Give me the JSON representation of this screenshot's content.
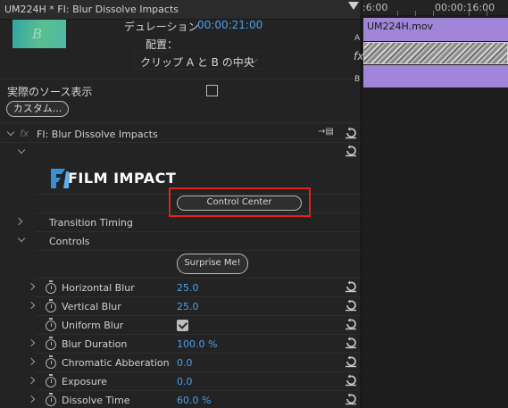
{
  "title": "UM224H * FI: Blur Dissolve Impacts",
  "thumbnail_letter": "B",
  "duration": {
    "label": "デュレーション",
    "value": "00:00:21:00"
  },
  "alignment": {
    "label": "配置：",
    "selected": "クリップ A と B の中央"
  },
  "show_actual_sources": {
    "label": "実際のソース表示",
    "checked": false
  },
  "custom_button": "カスタム...",
  "effect": {
    "name": "FI: Blur Dissolve Impacts",
    "logo_text": "FILM IMPACT",
    "control_center": "Control Center",
    "transition_timing": "Transition Timing",
    "controls": "Controls",
    "surprise": "Surprise Me!"
  },
  "properties": [
    {
      "label": "Horizontal Blur",
      "value": "25.0",
      "type": "value",
      "expandable": true
    },
    {
      "label": "Vertical Blur",
      "value": "25.0",
      "type": "value",
      "expandable": true
    },
    {
      "label": "Uniform Blur",
      "value": "",
      "type": "checkbox",
      "checked": true,
      "expandable": false
    },
    {
      "label": "Blur Duration",
      "value": "100.0 %",
      "type": "value",
      "expandable": true
    },
    {
      "label": "Chromatic Abberation",
      "value": "0.0",
      "type": "value",
      "expandable": true
    },
    {
      "label": "Exposure",
      "value": "0.0",
      "type": "value",
      "expandable": true
    },
    {
      "label": "Dissolve Time",
      "value": "60.0 %",
      "type": "value",
      "expandable": true
    }
  ],
  "timeline": {
    "ruler_left": ":6:00",
    "ruler_right": "00:00:16:00",
    "clip_a_name": "UM224H.mov",
    "track_labels": {
      "a": "A",
      "fx": "fx",
      "b": "B"
    }
  },
  "colors": {
    "accent_blue": "#4aa0ef",
    "clip_purple": "#a185d8",
    "highlight_red": "#e2221c"
  }
}
